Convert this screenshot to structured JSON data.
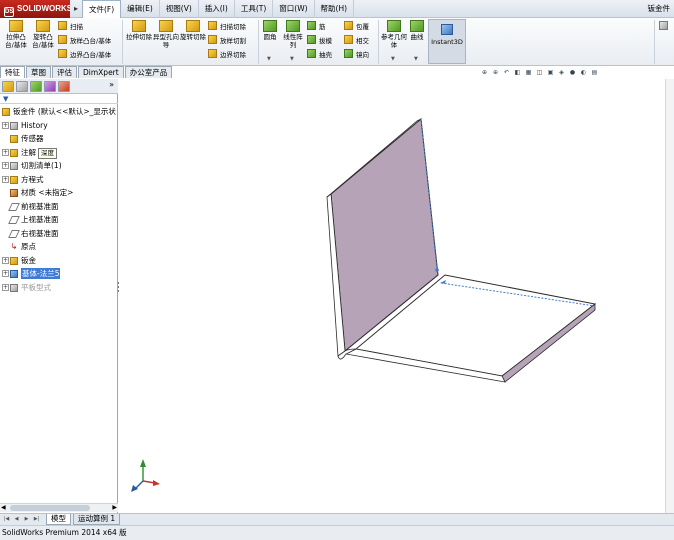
{
  "app": {
    "logo": "SOLIDWORKS",
    "document_title": "钣金件"
  },
  "menu": [
    {
      "label": "文件(F)",
      "active": true
    },
    {
      "label": "编辑(E)",
      "active": false
    },
    {
      "label": "视图(V)",
      "active": false
    },
    {
      "label": "插入(I)",
      "active": false
    },
    {
      "label": "工具(T)",
      "active": false
    },
    {
      "label": "窗口(W)",
      "active": false
    },
    {
      "label": "帮助(H)",
      "active": false
    }
  ],
  "ribbon": {
    "extrude_boss": "拉伸凸台/基体",
    "revolve_boss": "旋转凸台/基体",
    "sweep": "扫描",
    "loft_boss": "放样凸台/基体",
    "boundary_boss": "边界凸台/基体",
    "extrude_cut": "拉伸切除",
    "hole_wizard": "异型孔向导",
    "revolve_cut": "旋转切除",
    "swept_cut": "扫描切除",
    "lofted_cut": "放样切割",
    "boundary_cut": "边界切除",
    "fillet": "圆角",
    "linear_pattern": "线性阵列",
    "rib": "筋",
    "draft": "拔模",
    "shell": "抽壳",
    "wrap": "包覆",
    "intersect": "相交",
    "mirror": "镜向",
    "reference_geometry": "参考几何体",
    "curves": "曲线",
    "instant3d": "Instant3D"
  },
  "tabs": [
    {
      "label": "特征",
      "active": true
    },
    {
      "label": "草图",
      "active": false
    },
    {
      "label": "评估",
      "active": false
    },
    {
      "label": "DimXpert",
      "active": false
    },
    {
      "label": "办公室产品",
      "active": false
    }
  ],
  "feature_tree": {
    "root": "钣金件 (默认<<默认>_显示状",
    "tooltip": "深度",
    "items": [
      {
        "label": "History",
        "expandable": true,
        "icon": "history-icon",
        "state": "normal"
      },
      {
        "label": "传感器",
        "expandable": false,
        "icon": "sensor-icon",
        "state": "normal"
      },
      {
        "label": "注解",
        "expandable": true,
        "icon": "annotation-icon",
        "state": "normal"
      },
      {
        "label": "切割清单(1)",
        "expandable": true,
        "icon": "cut-list-icon",
        "state": "normal"
      },
      {
        "label": "方程式",
        "expandable": true,
        "icon": "equation-icon",
        "state": "normal"
      },
      {
        "label": "材质 <未指定>",
        "expandable": false,
        "icon": "material-icon",
        "state": "normal"
      },
      {
        "label": "前视基准面",
        "expandable": false,
        "icon": "plane-icon",
        "state": "normal"
      },
      {
        "label": "上视基准面",
        "expandable": false,
        "icon": "plane-icon",
        "state": "normal"
      },
      {
        "label": "右视基准面",
        "expandable": false,
        "icon": "plane-icon",
        "state": "normal"
      },
      {
        "label": "原点",
        "expandable": false,
        "icon": "origin-icon",
        "state": "normal"
      },
      {
        "label": "钣金",
        "expandable": true,
        "icon": "sheet-metal-icon",
        "state": "normal"
      },
      {
        "label": "基体-法兰5",
        "expandable": true,
        "icon": "base-flange-icon",
        "state": "selected"
      },
      {
        "label": "平板型式",
        "expandable": true,
        "icon": "flat-pattern-icon",
        "state": "greyed"
      }
    ]
  },
  "bottom_tabs": [
    {
      "label": "模型",
      "active": true
    },
    {
      "label": "运动算例 1",
      "active": false
    }
  ],
  "status": "SolidWorks Premium 2014 x64 版",
  "colors": {
    "face_shaded": "#b7a3b7",
    "edge": "#2c2c2c",
    "selection": "#3e7bd6",
    "menu_bg": "#dfe6ee"
  }
}
